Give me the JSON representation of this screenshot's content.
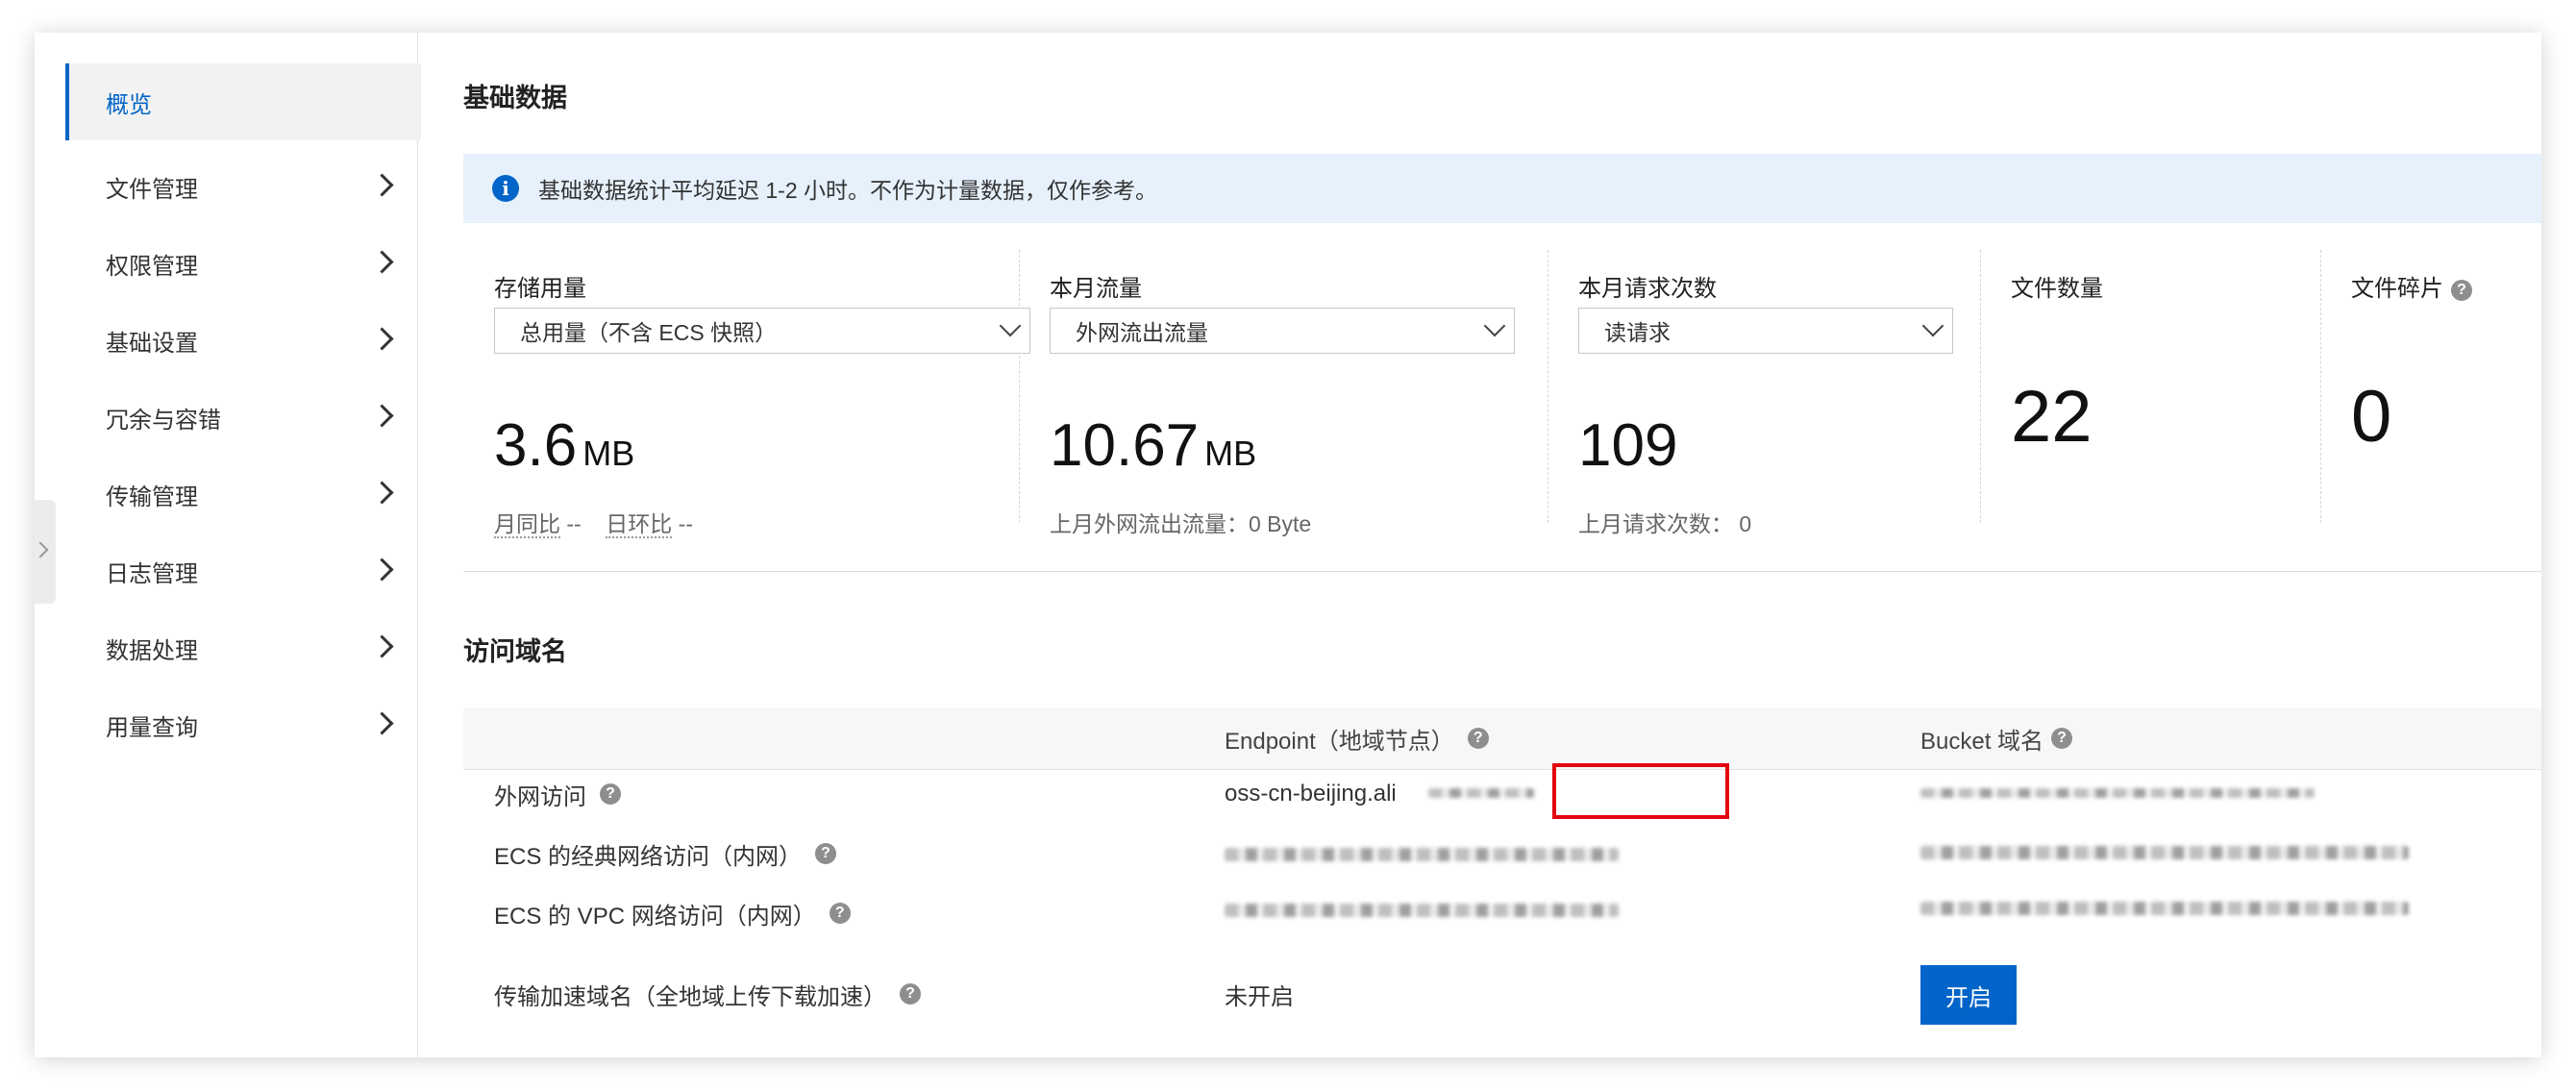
{
  "sidebar": {
    "items": [
      {
        "label": "概览",
        "active": true
      },
      {
        "label": "文件管理"
      },
      {
        "label": "权限管理"
      },
      {
        "label": "基础设置"
      },
      {
        "label": "冗余与容错"
      },
      {
        "label": "传输管理"
      },
      {
        "label": "日志管理"
      },
      {
        "label": "数据处理"
      },
      {
        "label": "用量查询"
      }
    ]
  },
  "basic": {
    "title": "基础数据",
    "info": "基础数据统计平均延迟 1-2 小时。不作为计量数据，仅作参考。",
    "storage": {
      "label": "存储用量",
      "select": "总用量（不含 ECS 快照）",
      "value": "3.6",
      "unit": "MB",
      "yoy_label": "月同比",
      "yoy_value": "--",
      "dod_label": "日环比",
      "dod_value": "--"
    },
    "traffic": {
      "label": "本月流量",
      "select": "外网流出流量",
      "value": "10.67",
      "unit": "MB",
      "sub": "上月外网流出流量：0 Byte"
    },
    "requests": {
      "label": "本月请求次数",
      "select": "读请求",
      "value": "109",
      "sub": "上月请求次数：  0"
    },
    "files": {
      "label": "文件数量",
      "value": "22"
    },
    "fragments": {
      "label": "文件碎片",
      "value": "0"
    }
  },
  "domains": {
    "title": "访问域名",
    "headers": {
      "endpoint": "Endpoint（地域节点）",
      "bucket": "Bucket 域名"
    },
    "rows": [
      {
        "label": "外网访问",
        "endpoint": "oss-cn-beijing.ali"
      },
      {
        "label": "ECS 的经典网络访问（内网）"
      },
      {
        "label": "ECS 的 VPC 网络访问（内网）"
      },
      {
        "label": "传输加速域名（全地域上传下载加速）",
        "endpoint": "未开启",
        "button": "开启"
      }
    ]
  },
  "icons": {
    "info": "info-icon",
    "help": "question-icon",
    "chevron": "chevron-right-icon",
    "dropdown": "chevron-down-icon"
  },
  "colors": {
    "accent": "#0064c8",
    "highlight": "#e3000f",
    "info_bg": "#e6f1fc"
  }
}
